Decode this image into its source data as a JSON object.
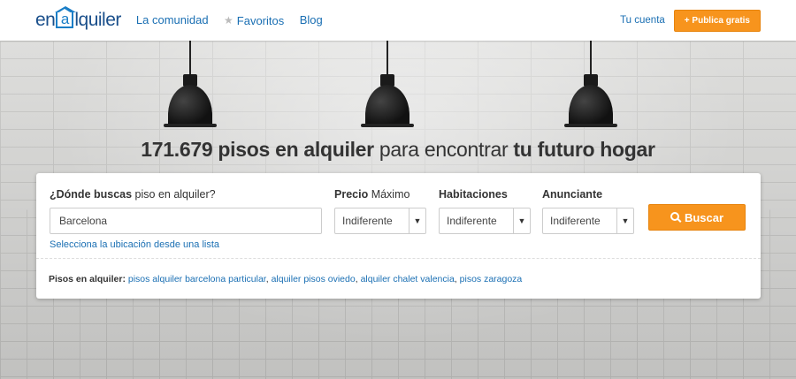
{
  "header": {
    "logo": {
      "prefix": "en",
      "mark": "a",
      "suffix": "lquiler"
    },
    "nav": [
      {
        "label": "La comunidad"
      },
      {
        "label": "Favoritos"
      },
      {
        "label": "Blog"
      }
    ],
    "account_link": "Tu cuenta",
    "publish_button": "+ Publica gratis"
  },
  "hero": {
    "headline_count": "171.679 pisos en alquiler",
    "headline_middle": " para encontrar ",
    "headline_end": "tu futuro hogar"
  },
  "search": {
    "location_label_bold": "¿Dónde buscas",
    "location_label_rest": " piso en alquiler?",
    "location_value": "Barcelona",
    "location_list_link": "Selecciona la ubicación desde una lista",
    "price_label_bold": "Precio",
    "price_label_rest": " Máximo",
    "price_value": "Indiferente",
    "rooms_label": "Habitaciones",
    "rooms_value": "Indiferente",
    "advertiser_label": "Anunciante",
    "advertiser_value": "Indiferente",
    "search_button": "Buscar"
  },
  "popular": {
    "label": "Pisos en alquiler:",
    "links": [
      "pisos alquiler barcelona particular",
      "alquiler pisos oviedo",
      "alquiler chalet valencia",
      "pisos zaragoza"
    ]
  },
  "colors": {
    "brand_blue": "#1a4f8b",
    "link_blue": "#1a6fb3",
    "accent_orange": "#f7941d"
  }
}
